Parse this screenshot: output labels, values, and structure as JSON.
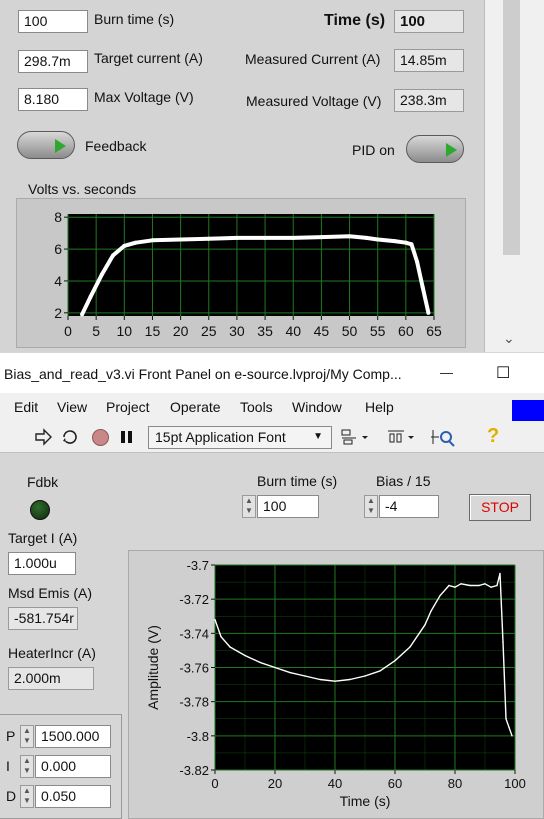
{
  "top_panel": {
    "burn_time_value": "100",
    "burn_time_label": "Burn time (s)",
    "target_current_value": "298.7m",
    "target_current_label": "Target current (A)",
    "max_voltage_value": "8.180",
    "max_voltage_label": "Max Voltage (V)",
    "time_label": "Time (s)",
    "time_value": "100",
    "measured_current_label": "Measured Current (A)",
    "measured_current_value": "14.85m",
    "measured_voltage_label": "Measured Voltage (V)",
    "measured_voltage_value": "238.3m",
    "feedback_label": "Feedback",
    "pid_label": "PID on",
    "scroll_down": "⌄",
    "toggle_arrow_color": "#2ea82e"
  },
  "window": {
    "title": "Bias_and_read_v3.vi Front Panel on e-source.lvproj/My Comp...",
    "minimize": "—",
    "maximize": "☐"
  },
  "menu": [
    "Edit",
    "View",
    "Project",
    "Operate",
    "Tools",
    "Window",
    "Help"
  ],
  "toolbar": {
    "font_select": "15pt Application Font",
    "font_arrow": "▼",
    "help_glyph": "?"
  },
  "bottom_panel": {
    "fdbk_label": "Fdbk",
    "burn_time_label": "Burn time (s)",
    "burn_time_value": "100",
    "bias_label": "Bias / 15",
    "bias_value": "-4",
    "stop_label": "STOP",
    "target_i_label": "Target I (A)",
    "target_i_value": "1.000u",
    "msd_emis_label": "Msd Emis (A)",
    "msd_emis_value": "-581.754r",
    "heater_label": "HeaterIncr (A)",
    "heater_value": "2.000m",
    "p_label": "P",
    "p_value": "1500.000",
    "i_label": "I",
    "i_value": "0.000",
    "d_label": "D",
    "d_value": "0.050",
    "spin_up": "▲",
    "spin_down": "▼"
  },
  "chart_data": [
    {
      "type": "line",
      "title": "Volts vs. seconds",
      "xlabel": "",
      "ylabel": "",
      "xlim": [
        0,
        65
      ],
      "ylim": [
        1.8,
        8.2
      ],
      "xticks": [
        0,
        5,
        10,
        15,
        20,
        25,
        30,
        35,
        40,
        45,
        50,
        55,
        60,
        65
      ],
      "yticks": [
        2,
        4,
        6,
        8
      ],
      "grid": true,
      "line_color": "#ffffff",
      "plot_bg": "#000000",
      "grid_color": "#1f7a1f",
      "series": [
        {
          "x": [
            2.5,
            4,
            6,
            8,
            10,
            12,
            15,
            20,
            25,
            30,
            35,
            40,
            45,
            50,
            53,
            55,
            58,
            60,
            61,
            62,
            63,
            64
          ],
          "y": [
            1.9,
            3.0,
            4.4,
            5.6,
            6.2,
            6.4,
            6.55,
            6.6,
            6.65,
            6.7,
            6.7,
            6.7,
            6.75,
            6.8,
            6.7,
            6.6,
            6.5,
            6.4,
            6.3,
            5.2,
            3.6,
            2.0
          ]
        }
      ]
    },
    {
      "type": "line",
      "title": "",
      "xlabel": "Time (s)",
      "ylabel": "Amplitude (V)",
      "xlim": [
        0,
        100
      ],
      "ylim": [
        -3.82,
        -3.7
      ],
      "xticks": [
        0,
        20,
        40,
        60,
        80,
        100
      ],
      "yticks": [
        -3.82,
        -3.8,
        -3.78,
        -3.76,
        -3.74,
        -3.72,
        -3.7
      ],
      "grid": true,
      "line_color": "#ffffff",
      "plot_bg": "#000000",
      "grid_color": "#1f7a1f",
      "series": [
        {
          "x": [
            0,
            2,
            5,
            10,
            15,
            20,
            25,
            30,
            35,
            40,
            45,
            50,
            55,
            60,
            65,
            70,
            72,
            75,
            78,
            80,
            82,
            85,
            88,
            90,
            92,
            94,
            95,
            96,
            97,
            98,
            99
          ],
          "y": [
            -3.732,
            -3.742,
            -3.748,
            -3.753,
            -3.757,
            -3.76,
            -3.763,
            -3.765,
            -3.767,
            -3.768,
            -3.767,
            -3.765,
            -3.762,
            -3.756,
            -3.748,
            -3.735,
            -3.727,
            -3.718,
            -3.712,
            -3.713,
            -3.711,
            -3.712,
            -3.712,
            -3.711,
            -3.713,
            -3.712,
            -3.705,
            -3.745,
            -3.79,
            -3.795,
            -3.8
          ]
        }
      ]
    }
  ]
}
